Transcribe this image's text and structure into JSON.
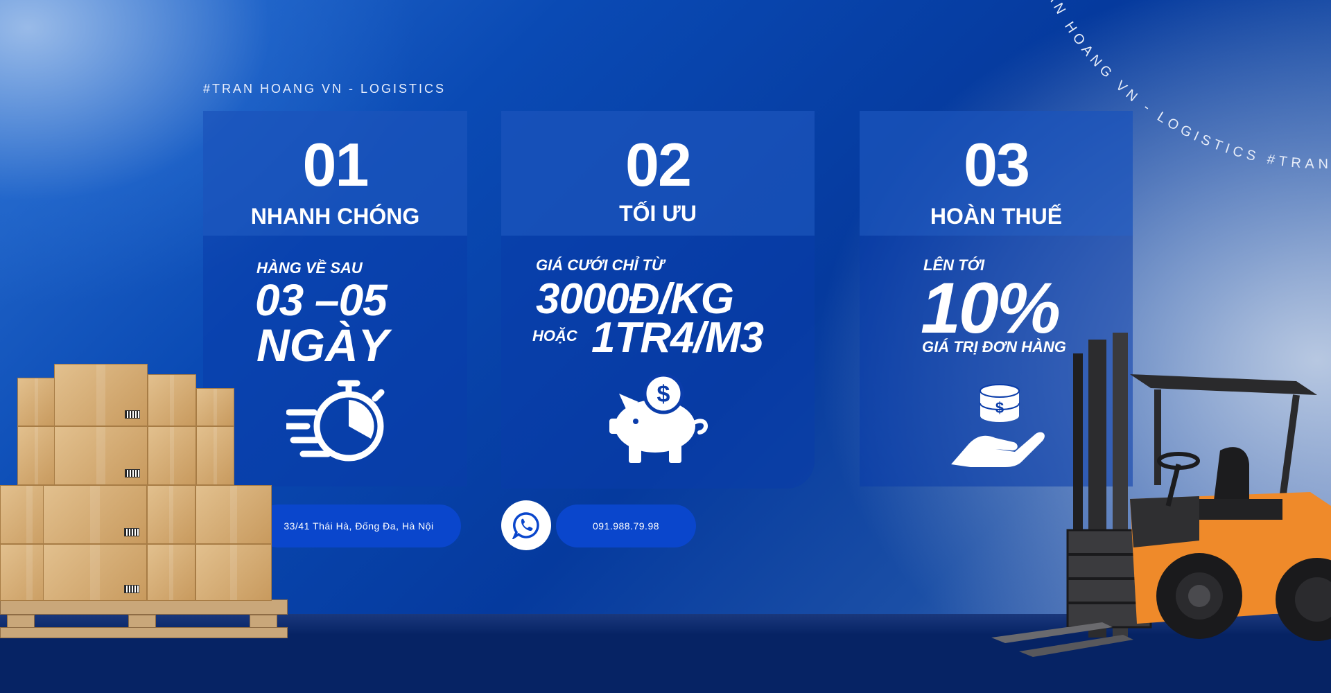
{
  "brand_tag": "#TRAN HOANG VN - LOGISTICS",
  "arc_text": "#TRAN HOANG VN - LOGISTICS #TRAN HOANG VN - LOGISTICS",
  "cards": [
    {
      "number": "01",
      "title": "NHANH CHÓNG",
      "line1": "HÀNG VỀ SAU",
      "line2": "03 –05",
      "line3": "NGÀY",
      "icon": "stopwatch-icon"
    },
    {
      "number": "02",
      "title": "TỐI ƯU",
      "line1": "GIÁ CƯỚI CHỈ TỪ",
      "line2": "3000Đ/KG",
      "line3_prefix": "HOẶC",
      "line3": "1TR4/M3",
      "icon": "piggy-bank-icon"
    },
    {
      "number": "03",
      "title": "HOÀN THUẾ",
      "line1": "LÊN TỚI",
      "line2": "10%",
      "line3": "GIÁ TRỊ ĐƠN HÀNG",
      "icon": "hand-coins-icon"
    }
  ],
  "contacts": {
    "address": "33/41 Thái Hà, Đống Đa, Hà Nội",
    "phone": "091.988.79.98"
  },
  "colors": {
    "accent": "#0a46cc",
    "card": "#0a3caa",
    "background_dark": "#062364"
  }
}
